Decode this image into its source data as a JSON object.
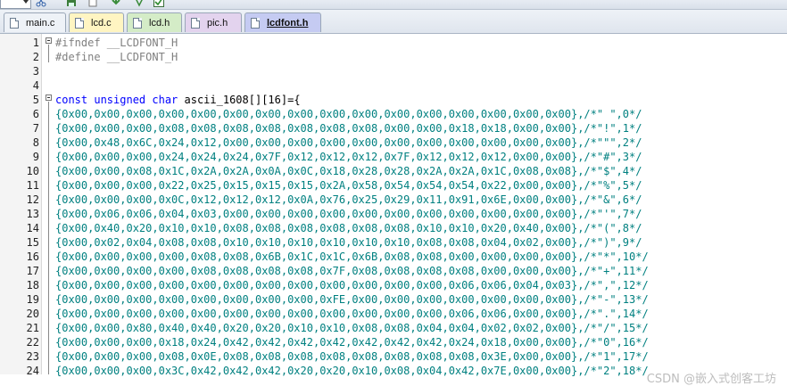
{
  "toolbar": {
    "icons": [
      "combo-box",
      "scissors-icon",
      "save-icon",
      "copy-icon",
      "find-icon",
      "check-icon"
    ]
  },
  "tabs": [
    {
      "label": "main.c",
      "color": "#eef2f7"
    },
    {
      "label": "lcd.c",
      "color": "#fff5c2"
    },
    {
      "label": "lcd.h",
      "color": "#d4ecc7"
    },
    {
      "label": "pic.h",
      "color": "#e3d3ee"
    },
    {
      "label": "lcdfont.h",
      "color": "#c5cbf2",
      "active": true
    }
  ],
  "editor": {
    "lines": [
      {
        "n": "1",
        "kind": "pre",
        "text": "#ifndef __LCDFONT_H"
      },
      {
        "n": "2",
        "kind": "pre",
        "text": "#define __LCDFONT_H"
      },
      {
        "n": "3",
        "kind": "blank",
        "text": ""
      },
      {
        "n": "4",
        "kind": "blank",
        "text": ""
      },
      {
        "n": "5",
        "kind": "decl",
        "kw": "const unsigned char",
        "rest": " ascii_1608[][16]={"
      },
      {
        "n": "6",
        "kind": "data",
        "text": "{0x00,0x00,0x00,0x00,0x00,0x00,0x00,0x00,0x00,0x00,0x00,0x00,0x00,0x00,0x00,0x00},/*\" \",0*/"
      },
      {
        "n": "7",
        "kind": "data",
        "text": "{0x00,0x00,0x00,0x08,0x08,0x08,0x08,0x08,0x08,0x08,0x00,0x00,0x18,0x18,0x00,0x00},/*\"!\",1*/"
      },
      {
        "n": "8",
        "kind": "data",
        "text": "{0x00,0x48,0x6C,0x24,0x12,0x00,0x00,0x00,0x00,0x00,0x00,0x00,0x00,0x00,0x00,0x00},/*\"\"\",2*/"
      },
      {
        "n": "9",
        "kind": "data",
        "text": "{0x00,0x00,0x00,0x24,0x24,0x24,0x7F,0x12,0x12,0x12,0x7F,0x12,0x12,0x12,0x00,0x00},/*\"#\",3*/"
      },
      {
        "n": "10",
        "kind": "data",
        "text": "{0x00,0x00,0x08,0x1C,0x2A,0x2A,0x0A,0x0C,0x18,0x28,0x28,0x2A,0x2A,0x1C,0x08,0x08},/*\"$\",4*/"
      },
      {
        "n": "11",
        "kind": "data",
        "text": "{0x00,0x00,0x00,0x22,0x25,0x15,0x15,0x15,0x2A,0x58,0x54,0x54,0x54,0x22,0x00,0x00},/*\"%\",5*/"
      },
      {
        "n": "12",
        "kind": "data",
        "text": "{0x00,0x00,0x00,0x0C,0x12,0x12,0x12,0x0A,0x76,0x25,0x29,0x11,0x91,0x6E,0x00,0x00},/*\"&\",6*/"
      },
      {
        "n": "13",
        "kind": "data",
        "text": "{0x00,0x06,0x06,0x04,0x03,0x00,0x00,0x00,0x00,0x00,0x00,0x00,0x00,0x00,0x00,0x00},/*\"'\",7*/"
      },
      {
        "n": "14",
        "kind": "data",
        "text": "{0x00,0x40,0x20,0x10,0x10,0x08,0x08,0x08,0x08,0x08,0x08,0x10,0x10,0x20,0x40,0x00},/*\"(\",8*/"
      },
      {
        "n": "15",
        "kind": "data",
        "text": "{0x00,0x02,0x04,0x08,0x08,0x10,0x10,0x10,0x10,0x10,0x10,0x08,0x08,0x04,0x02,0x00},/*\")\",9*/"
      },
      {
        "n": "16",
        "kind": "data",
        "text": "{0x00,0x00,0x00,0x00,0x08,0x08,0x6B,0x1C,0x1C,0x6B,0x08,0x08,0x00,0x00,0x00,0x00},/*\"*\",10*/"
      },
      {
        "n": "17",
        "kind": "data",
        "text": "{0x00,0x00,0x00,0x00,0x08,0x08,0x08,0x08,0x7F,0x08,0x08,0x08,0x08,0x00,0x00,0x00},/*\"+\",11*/"
      },
      {
        "n": "18",
        "kind": "data",
        "text": "{0x00,0x00,0x00,0x00,0x00,0x00,0x00,0x00,0x00,0x00,0x00,0x00,0x06,0x06,0x04,0x03},/*\",\",12*/"
      },
      {
        "n": "19",
        "kind": "data",
        "text": "{0x00,0x00,0x00,0x00,0x00,0x00,0x00,0x00,0xFE,0x00,0x00,0x00,0x00,0x00,0x00,0x00},/*\"-\",13*/"
      },
      {
        "n": "20",
        "kind": "data",
        "text": "{0x00,0x00,0x00,0x00,0x00,0x00,0x00,0x00,0x00,0x00,0x00,0x00,0x06,0x06,0x00,0x00},/*\".\",14*/"
      },
      {
        "n": "21",
        "kind": "data",
        "text": "{0x00,0x00,0x80,0x40,0x40,0x20,0x20,0x10,0x10,0x08,0x08,0x04,0x04,0x02,0x02,0x00},/*\"/\",15*/"
      },
      {
        "n": "22",
        "kind": "data",
        "text": "{0x00,0x00,0x00,0x18,0x24,0x42,0x42,0x42,0x42,0x42,0x42,0x42,0x24,0x18,0x00,0x00},/*\"0\",16*/"
      },
      {
        "n": "23",
        "kind": "data",
        "text": "{0x00,0x00,0x00,0x08,0x0E,0x08,0x08,0x08,0x08,0x08,0x08,0x08,0x08,0x3E,0x00,0x00},/*\"1\",17*/"
      },
      {
        "n": "24",
        "kind": "data",
        "text": "{0x00,0x00,0x00,0x3C,0x42,0x42,0x42,0x20,0x20,0x10,0x08,0x04,0x42,0x7E,0x00,0x00},/*\"2\",18*/"
      }
    ]
  },
  "watermark": "CSDN @嵌入式创客工坊"
}
